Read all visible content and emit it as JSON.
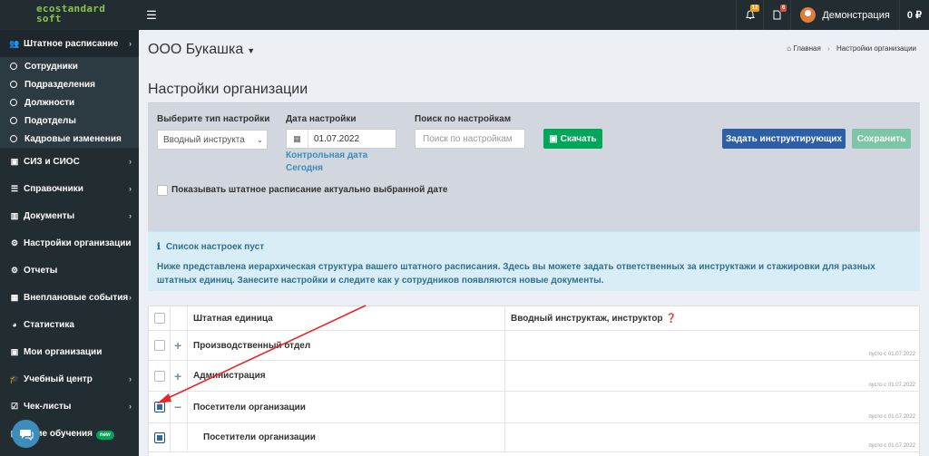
{
  "header": {
    "logo_line1": "ecostandard",
    "logo_line2": "soft",
    "notifications_count": "12",
    "documents_count": "6",
    "user_name": "Демонстрация",
    "balance": "0 ₽"
  },
  "sidebar": {
    "items": [
      {
        "label": "Штатное расписание",
        "icon": "users-icon"
      },
      {
        "label": "СИЗ и СИОС",
        "icon": "briefcase-icon"
      },
      {
        "label": "Справочники",
        "icon": "list-icon"
      },
      {
        "label": "Документы",
        "icon": "barcode-icon"
      },
      {
        "label": "Настройки организации",
        "icon": "gear-icon"
      },
      {
        "label": "Отчеты",
        "icon": "gear-icon"
      },
      {
        "label": "Внеплановые события",
        "icon": "calendar-icon"
      },
      {
        "label": "Статистика",
        "icon": "pie-chart-icon"
      },
      {
        "label": "Мои организации",
        "icon": "briefcase-icon"
      },
      {
        "label": "Учебный центр",
        "icon": "graduation-cap-icon"
      },
      {
        "label": "Чек-листы",
        "icon": "check-square-icon"
      },
      {
        "label": "шние обучения",
        "icon": "book-icon",
        "badge": "new"
      }
    ],
    "submenu": [
      "Сотрудники",
      "Подразделения",
      "Должности",
      "Подотделы",
      "Кадровые изменения"
    ]
  },
  "main": {
    "org_name": "ООО Букашка",
    "breadcrumb_home": "Главная",
    "breadcrumb_current": "Настройки организации",
    "page_title": "Настройки организации"
  },
  "settings": {
    "type_label": "Выберите тип настройки",
    "type_value": "Вводный инструкта",
    "date_label": "Дата настройки",
    "date_value": "01.07.2022",
    "control_date_link": "Контрольная дата",
    "today_link": "Сегодня",
    "search_label": "Поиск по настройкам",
    "search_placeholder": "Поиск по настройкам",
    "download_button": "Скачать",
    "assign_button": "Задать инструктирующих",
    "save_button": "Сохранить",
    "show_checkbox_label": "Показывать штатное расписание актуально выбранной дате"
  },
  "info": {
    "title": "Список настроек пуст",
    "text": "Ниже представлена иерархическая структура вашего штатного расписания. Здесь вы можете задать ответственных за инструктажи и стажировки для разных штатных единиц. Занесите настройки и следите как у сотрудников появляются новые документы."
  },
  "table": {
    "col_unit": "Штатная единица",
    "col_instructor": "Вводный инструктаж, инструктор",
    "rows": [
      {
        "name": "Производственный отдел",
        "sign": "+",
        "checked": false,
        "note": "пусто с 01.07.2022"
      },
      {
        "name": "Администрация",
        "sign": "+",
        "checked": false,
        "note": "пусто с 01.07.2022"
      },
      {
        "name": "Посетители организации",
        "sign": "−",
        "checked": true,
        "note": "пусто с 01.07.2022"
      },
      {
        "name": "Посетители организации",
        "sign": "",
        "checked": true,
        "note": "пусто с 01.07.2022"
      }
    ]
  },
  "colors": {
    "sidebar_bg": "#222d32",
    "accent_blue": "#3c8dbc",
    "success_green": "#00a65a",
    "arrow_red": "#e8262a"
  }
}
